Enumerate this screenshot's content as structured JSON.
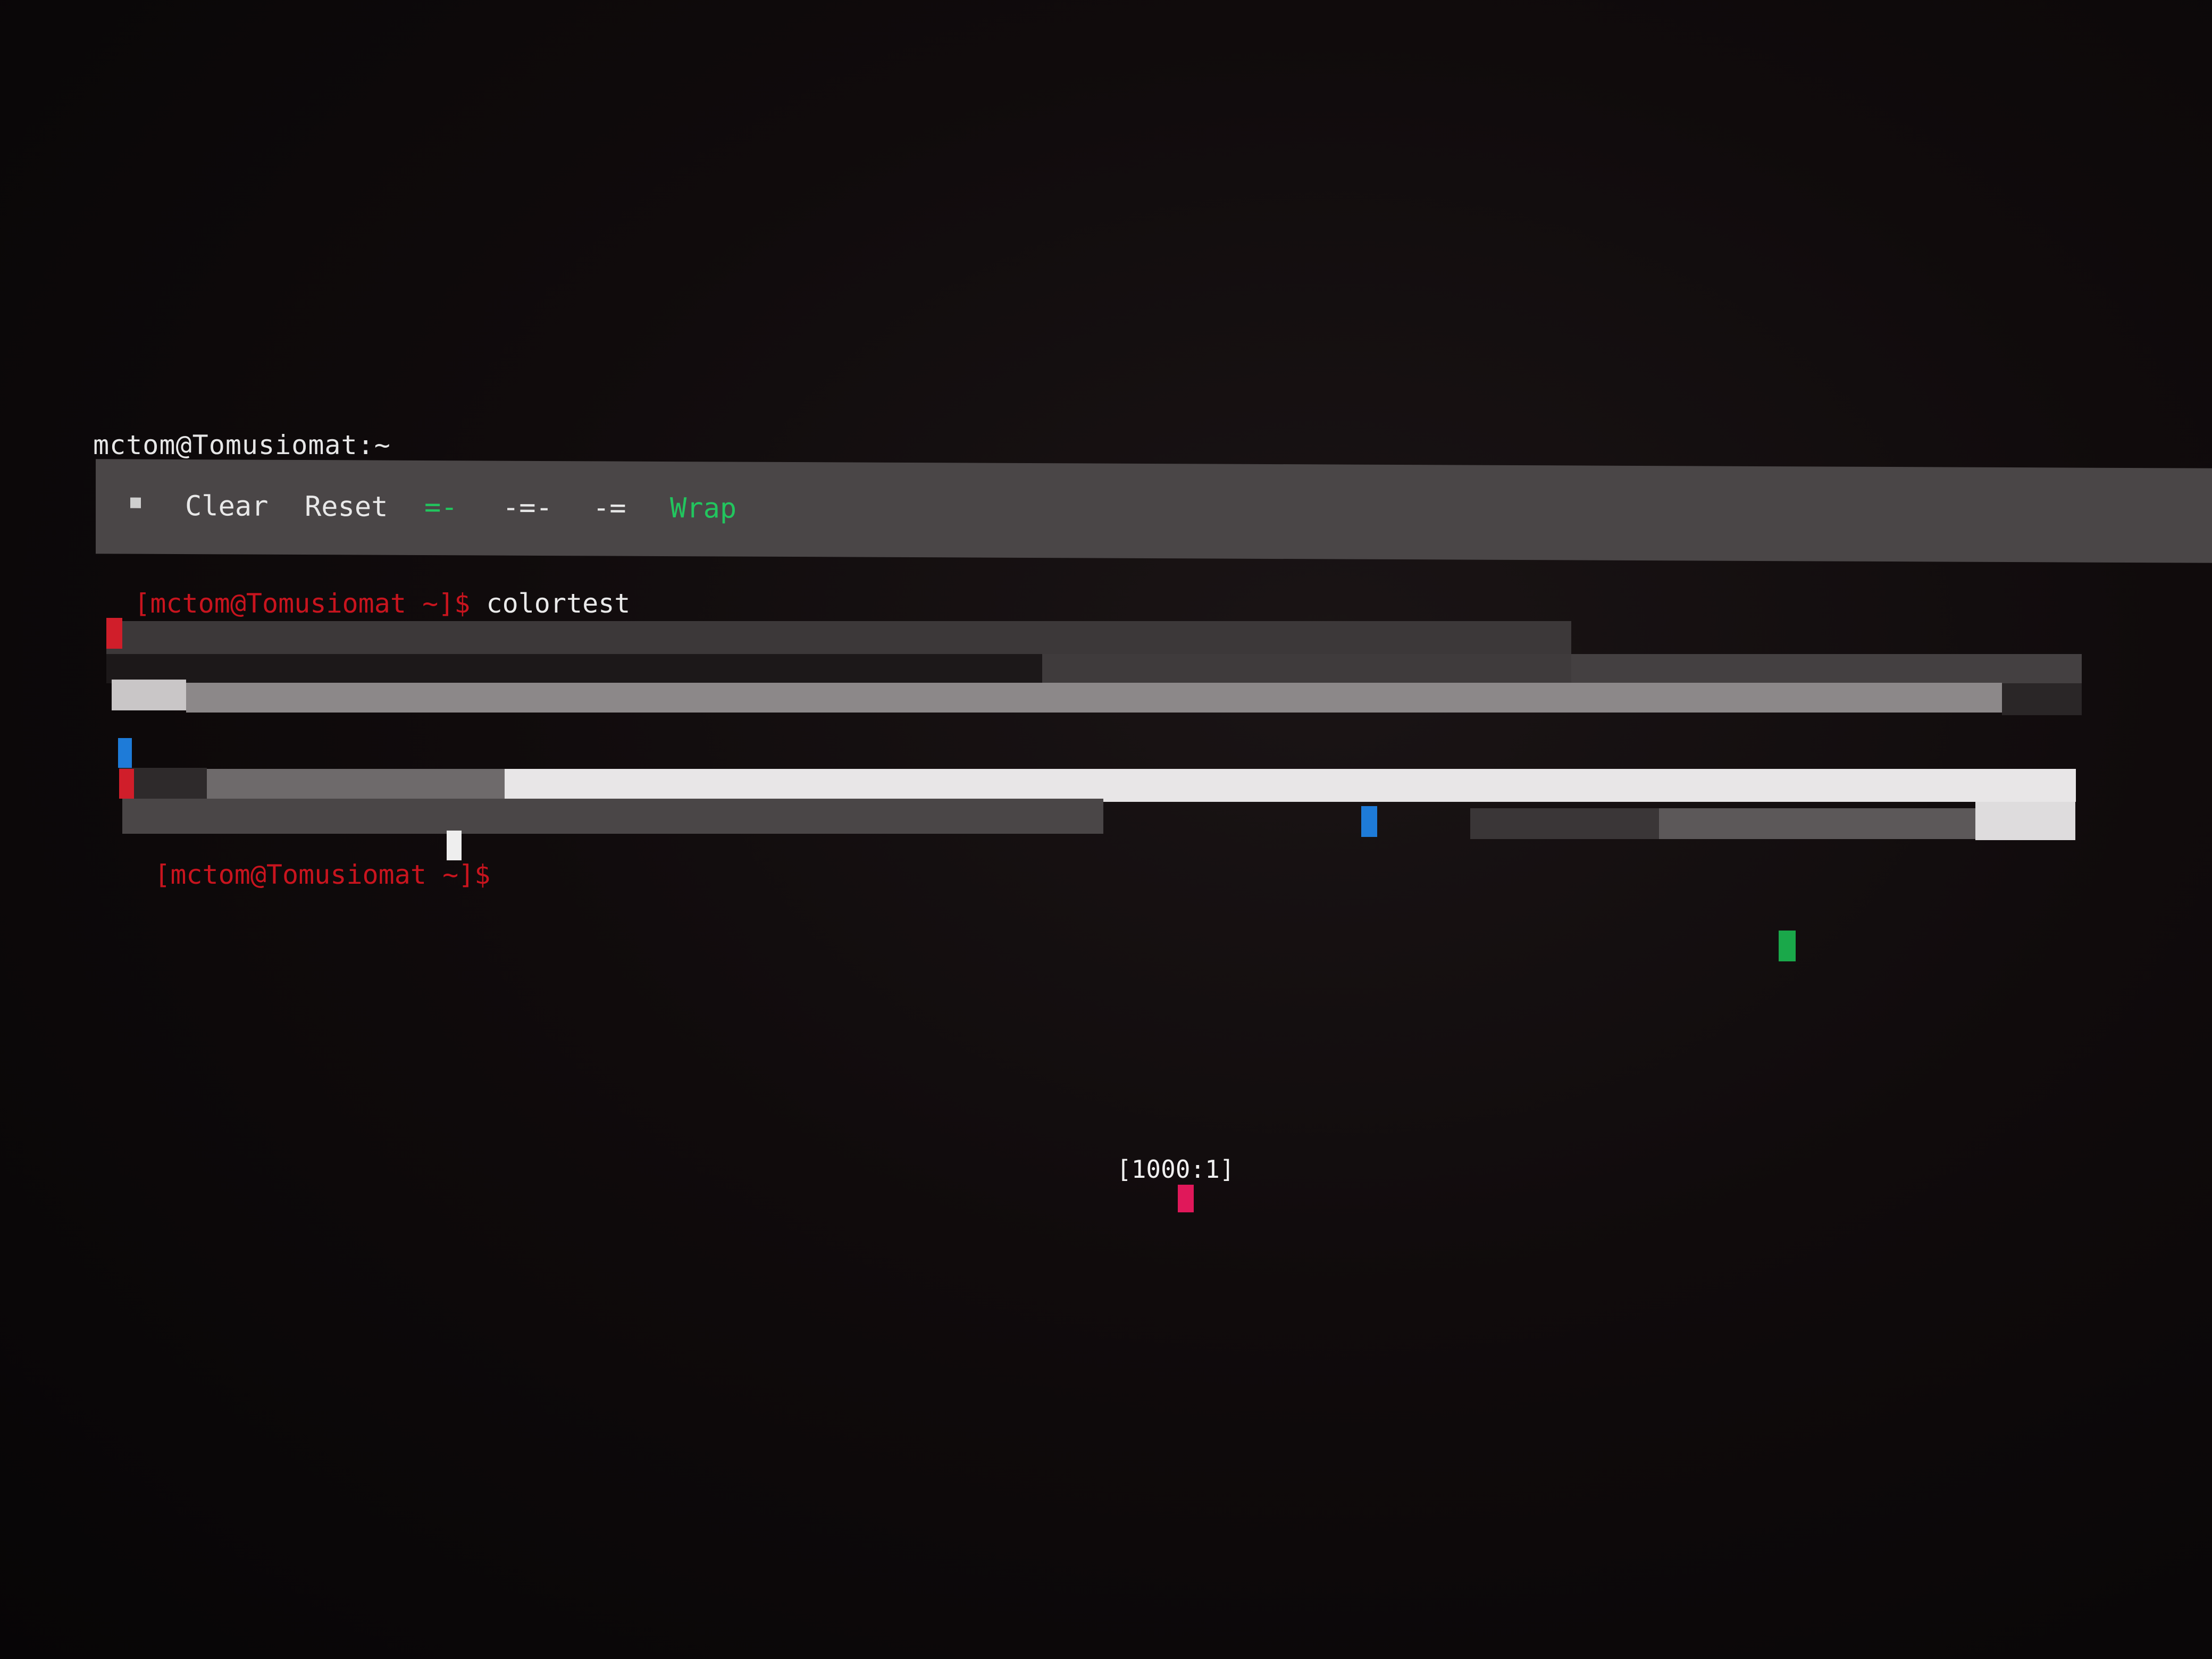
{
  "window": {
    "title": "mctom@Tomusiomat:~"
  },
  "toolbar": {
    "items": [
      {
        "label": "Clear",
        "color": "#e8e8e8"
      },
      {
        "label": "Reset",
        "color": "#e8e8e8"
      },
      {
        "label": "=-",
        "color": "#22c55e"
      },
      {
        "label": "-=-",
        "color": "#e8e8e8"
      },
      {
        "label": "-=",
        "color": "#e8e8e8"
      },
      {
        "label": "Wrap",
        "color": "#22c55e"
      }
    ]
  },
  "terminal": {
    "prompt": "[mctom@Tomusiomat ~]$",
    "command": "colortest",
    "prompt2": "[mctom@Tomusiomat ~]$"
  },
  "status": {
    "position": "[1000:1]"
  },
  "colors": {
    "prompt": "#c8141e",
    "accent_green": "#22c55e",
    "block_red": "#d01e2a",
    "block_blue": "#1e7bd8",
    "block_green": "#1aa84a",
    "block_pink": "#e0185a"
  }
}
